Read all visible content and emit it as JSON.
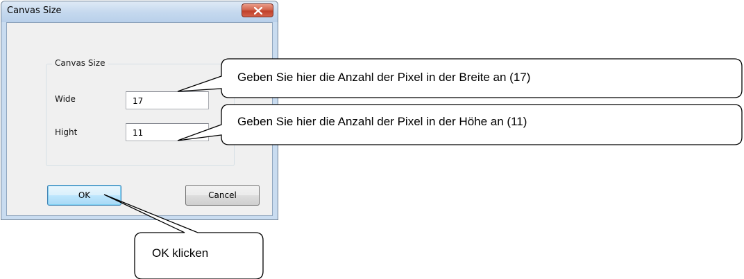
{
  "dialog": {
    "title": "Canvas Size",
    "group_label": "Canvas Size",
    "width_label": "Wide",
    "width_value": "17",
    "height_label": "Hight",
    "height_value": "11",
    "ok_label": "OK",
    "cancel_label": "Cancel"
  },
  "callouts": {
    "width_note": "Geben Sie hier die Anzahl der Pixel in der Breite an (17)",
    "height_note": "Geben Sie hier die Anzahl der Pixel in der Höhe an (11)",
    "ok_note": "OK klicken"
  },
  "colors": {
    "close_button": "#c0412b",
    "titlebar": "#c4d8ee",
    "default_button": "#a7d9f5"
  }
}
